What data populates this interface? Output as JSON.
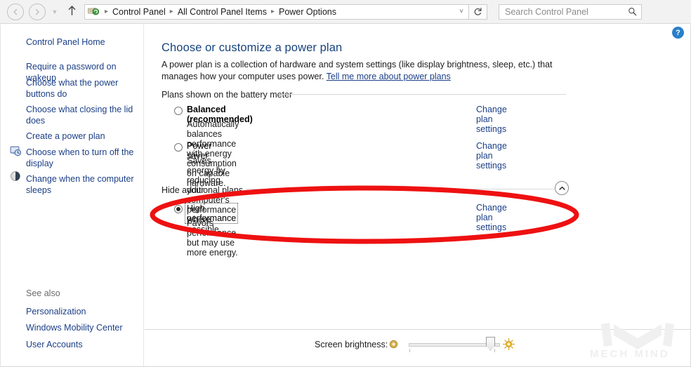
{
  "window": {
    "nav": {
      "back_icon": "arrow-left-circle-icon",
      "forward_icon": "arrow-right-circle-icon",
      "history_icon": "chevron-down-icon",
      "up_icon": "arrow-up-icon",
      "refresh_icon": "refresh-icon",
      "address_dropdown_icon": "chevron-down-icon"
    },
    "breadcrumb": {
      "icon": "control-panel-icon",
      "items": [
        "Control Panel",
        "All Control Panel Items",
        "Power Options"
      ],
      "separator": "▸"
    },
    "search": {
      "placeholder": "Search Control Panel",
      "value": "",
      "icon": "search-icon"
    },
    "help": {
      "label": "?",
      "icon": "help-icon"
    }
  },
  "sidebar": {
    "home_label": "Control Panel Home",
    "items": [
      {
        "label": "Require a password on wakeup",
        "icon": null
      },
      {
        "label": "Choose what the power",
        "label2": "buttons do",
        "icon": null
      },
      {
        "label": "Choose what closing the lid",
        "label2": "does",
        "icon": null
      },
      {
        "label": "Create a power plan",
        "icon": null
      },
      {
        "label": "Choose when to turn off the",
        "label2": "display",
        "icon": "monitor-clock-icon"
      },
      {
        "label": "Change when the computer",
        "label2": "sleeps",
        "icon": "moon-sleep-icon"
      }
    ],
    "see_also_label": "See also",
    "see_also_items": [
      "Personalization",
      "Windows Mobility Center",
      "User Accounts"
    ]
  },
  "main": {
    "title": "Choose or customize a power plan",
    "description_part1": "A power plan is a collection of hardware and system settings (like display brightness, sleep, etc.) that manages how your computer uses power. ",
    "description_link": "Tell me more about power plans",
    "group_header": "Plans shown on the battery meter",
    "additional_header": "Hide additional plans",
    "collapse_icon": "chevron-up-icon",
    "change_plan_settings_label": "Change plan settings",
    "plans": [
      {
        "name": "Balanced (recommended)",
        "description": "Automatically balances performance with energy consumption on capable hardware.",
        "selected": false,
        "bold": true,
        "focused": false,
        "action": "Change plan settings"
      },
      {
        "name": "Power saver",
        "description": "Saves energy by reducing your computer's performance where possible.",
        "selected": false,
        "bold": false,
        "focused": false,
        "action": "Change plan settings"
      },
      {
        "name": "High performance",
        "description": "Favors performance, but may use more energy.",
        "selected": true,
        "bold": false,
        "focused": true,
        "action": "Change plan settings"
      }
    ]
  },
  "brightness": {
    "label": "Screen brightness:",
    "low_icon": "dim-sun-icon",
    "high_icon": "bright-sun-icon",
    "value_percent": 92
  },
  "annotation": {
    "type": "red-ellipse-highlight",
    "color": "#ee1111",
    "target": "High performance"
  },
  "watermark": {
    "text": "MECH MIND",
    "color": "#efefef"
  }
}
